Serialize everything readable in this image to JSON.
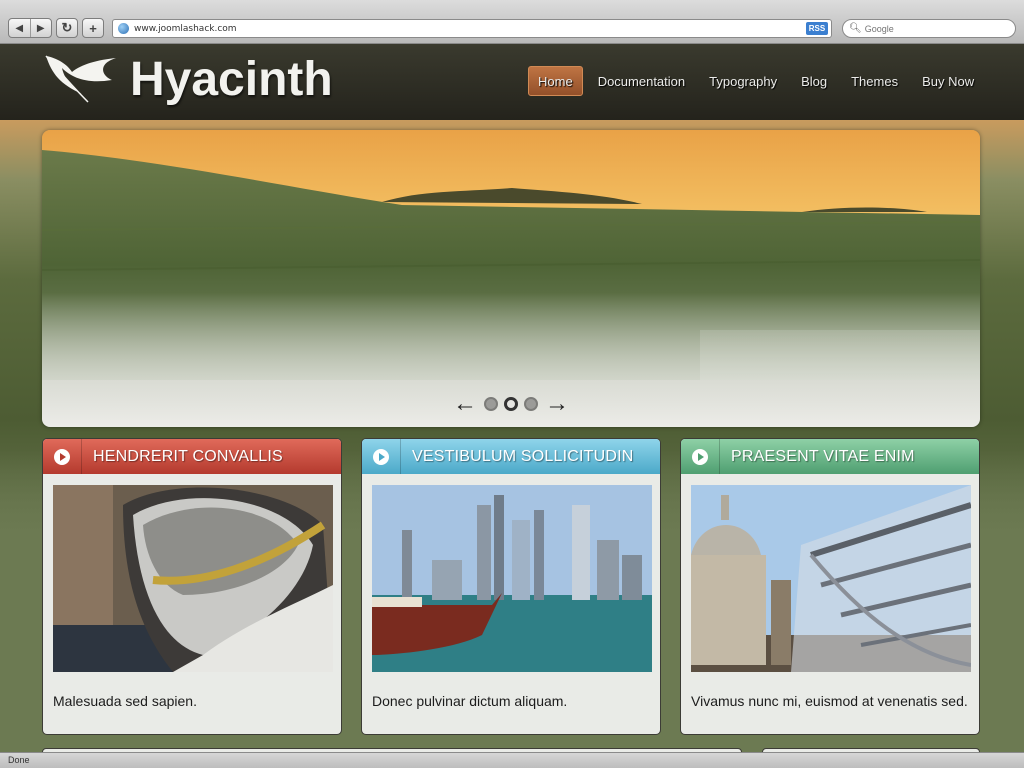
{
  "browser": {
    "url": "www.joomlashack.com",
    "rss_label": "RSS",
    "search_placeholder": "Google",
    "status": "Done"
  },
  "site": {
    "title": "Hyacinth",
    "nav": [
      {
        "label": "Home",
        "active": true
      },
      {
        "label": "Documentation"
      },
      {
        "label": "Typography"
      },
      {
        "label": "Blog"
      },
      {
        "label": "Themes"
      },
      {
        "label": "Buy Now"
      }
    ]
  },
  "slideshow": {
    "slide_count": 3,
    "active_slide": 2
  },
  "modules": [
    {
      "title": "HENDRERIT CONVALLIS",
      "text": "Malesuada sed sapien.",
      "color": "#c94a3c"
    },
    {
      "title": "VESTIBULUM SOLLICITUDIN",
      "text": "Donec pulvinar dictum aliquam.",
      "color": "#6cc0dc"
    },
    {
      "title": "PRAESENT VITAE ENIM",
      "text": "Vivamus nunc mi, euismod at venenatis sed.",
      "color": "#6db88a"
    }
  ]
}
